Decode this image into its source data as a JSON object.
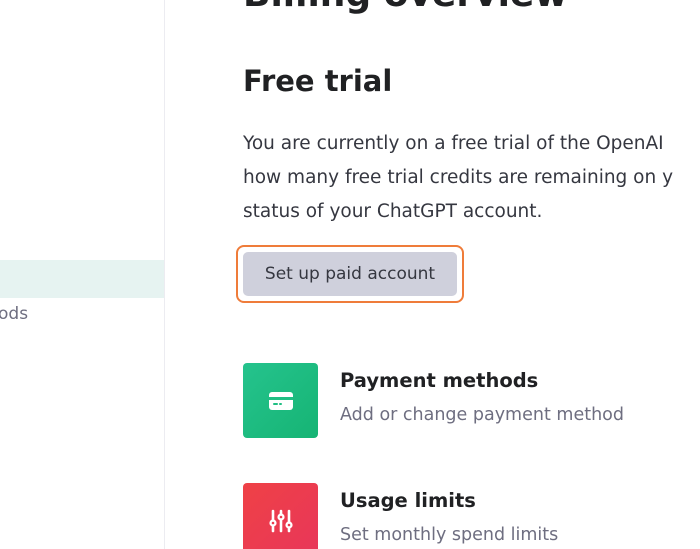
{
  "sidebar": {
    "active_item": "",
    "visible_item_label": "ods"
  },
  "main": {
    "page_title": "Billing overview",
    "section_title": "Free trial",
    "description_lines": [
      "You are currently on a free trial of the OpenAI",
      "how many free trial credits are remaining on y",
      "status of your ChatGPT account."
    ],
    "cta_label": "Set up paid account",
    "cards": [
      {
        "title": "Payment methods",
        "subtitle": "Add or change payment method",
        "icon": "credit-card-icon",
        "color": "#19c37d"
      },
      {
        "title": "Usage limits",
        "subtitle": "Set monthly spend limits",
        "icon": "sliders-icon",
        "color": "#ef4146"
      }
    ]
  },
  "colors": {
    "active_nav_bg": "#e6f3f1",
    "focus_ring": "#ef7c3a",
    "button_bg": "#cfd0dc"
  }
}
